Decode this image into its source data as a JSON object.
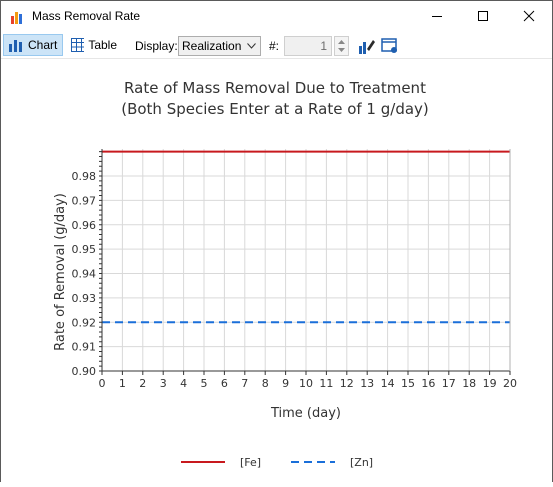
{
  "window": {
    "title": "Mass Removal Rate"
  },
  "toolbar": {
    "chart_label": "Chart",
    "table_label": "Table",
    "display_label": "Display:",
    "display_value": "Realization",
    "number_label": "#:",
    "number_value": "1"
  },
  "chart_data": {
    "type": "line",
    "title": "Rate of Mass Removal Due to Treatment",
    "subtitle": "(Both Species Enter at a Rate of 1 g/day)",
    "xlabel": "Time (day)",
    "ylabel": "Rate of Removal (g/day)",
    "xlim": [
      0,
      20
    ],
    "ylim": [
      0.9,
      0.99
    ],
    "xticks": [
      0,
      1,
      2,
      3,
      4,
      5,
      6,
      7,
      8,
      9,
      10,
      11,
      12,
      13,
      14,
      15,
      16,
      17,
      18,
      19,
      20
    ],
    "yticks": [
      0.9,
      0.91,
      0.92,
      0.93,
      0.94,
      0.95,
      0.96,
      0.97,
      0.98
    ],
    "grid": true,
    "legend_position": "bottom",
    "series": [
      {
        "name": "[Fe]",
        "color": "#c8191e",
        "style": "solid",
        "x": [
          0,
          20
        ],
        "y": [
          0.99,
          0.99
        ]
      },
      {
        "name": "[Zn]",
        "color": "#1a6fd9",
        "style": "dashed",
        "x": [
          0,
          20
        ],
        "y": [
          0.92,
          0.92
        ]
      }
    ]
  }
}
